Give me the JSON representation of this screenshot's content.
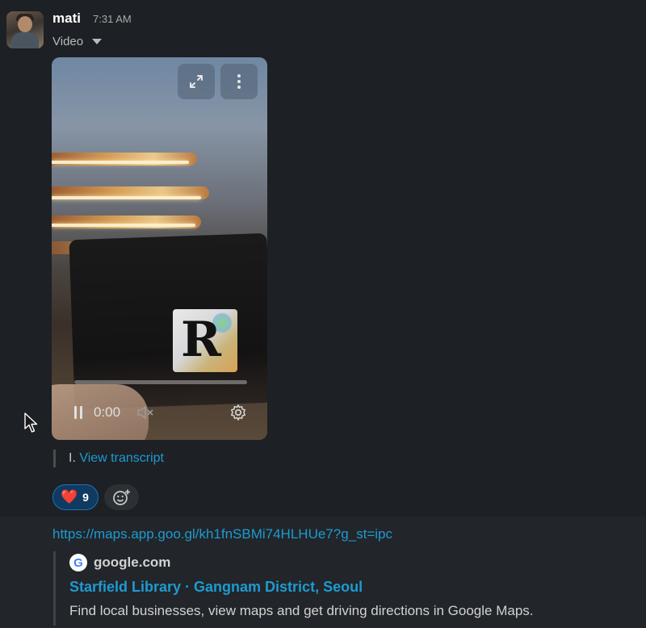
{
  "message": {
    "author": "mati",
    "time": "7:31 AM",
    "attachment_label": "Video",
    "video": {
      "current_time": "0:00",
      "progress": 0
    },
    "transcript": {
      "prefix": "I.",
      "link_label": "View transcript"
    },
    "reactions": [
      {
        "emoji": "❤️",
        "count": "9"
      }
    ]
  },
  "message2": {
    "link_url": "https://maps.app.goo.gl/kh1fnSBMi74HLHUe7?g_st=ipc",
    "unfurl": {
      "site": "google.com",
      "title": "Starfield Library · Gangnam District, Seoul",
      "description": "Find local businesses, view maps and get driving directions in Google Maps."
    }
  },
  "colors": {
    "link": "#1d9bd1",
    "reaction_bg": "#103a61",
    "background": "#1a1d21"
  },
  "icons": [
    "expand-icon",
    "more-icon",
    "pause-icon",
    "mute-icon",
    "settings-icon",
    "add-reaction-icon",
    "google-icon",
    "caret-down-icon",
    "mouse-cursor"
  ]
}
